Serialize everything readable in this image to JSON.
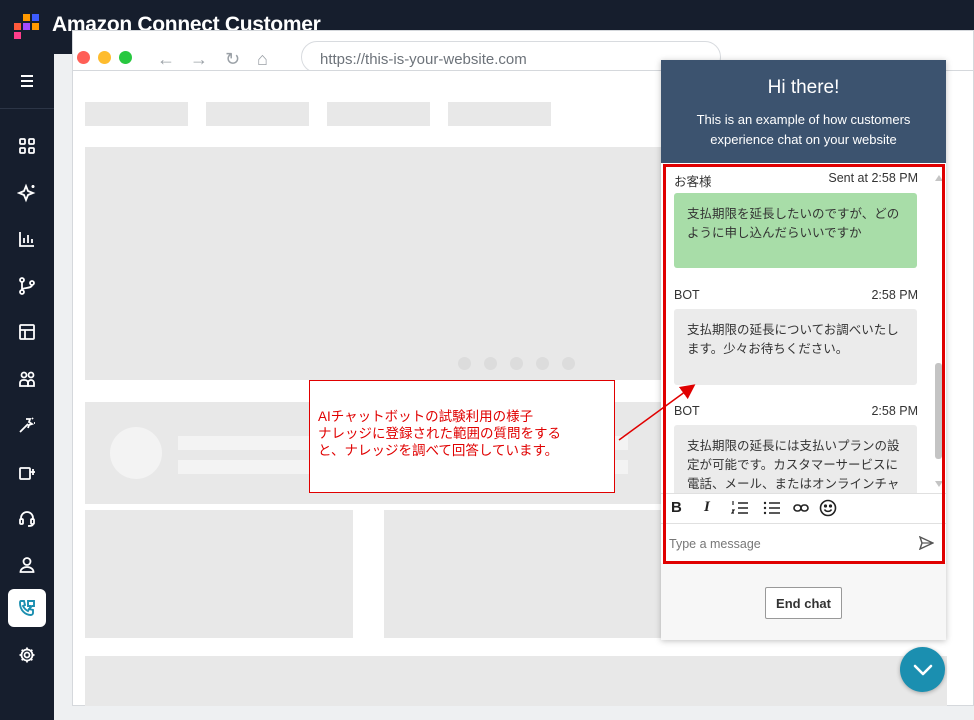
{
  "app": {
    "title": "Amazon Connect Customer",
    "logo_colors": [
      "#ff5a3c",
      "#ff9900",
      "#a44bff",
      "#3d5cff",
      "#ff3d8b"
    ]
  },
  "sidebar": {
    "items": [
      {
        "name": "menu-icon"
      },
      {
        "name": "dashboard-grid-icon"
      },
      {
        "name": "sparkle-ai-icon"
      },
      {
        "name": "analytics-chart-icon"
      },
      {
        "name": "flow-routing-icon"
      },
      {
        "name": "layout-panel-icon"
      },
      {
        "name": "users-group-icon"
      },
      {
        "name": "magic-wand-icon"
      },
      {
        "name": "queue-transfer-icon"
      },
      {
        "name": "headset-icon"
      },
      {
        "name": "user-profile-icon"
      },
      {
        "name": "phone-chat-icon",
        "active": true
      },
      {
        "name": "settings-gear-icon"
      }
    ]
  },
  "browser": {
    "url": "https://this-is-your-website.com"
  },
  "chat": {
    "greeting": "Hi there!",
    "subtitle": "This is an example of how customers experience chat on your website",
    "messages": [
      {
        "sender": "お客様",
        "time": "Sent at  2:58 PM",
        "text": "支払期限を延長したいのですが、どのように申し込んだらいいですか",
        "type": "customer"
      },
      {
        "sender": "BOT",
        "time": "2:58 PM",
        "text": "支払期限の延長についてお調べいたします。少々お待ちください。",
        "type": "bot"
      },
      {
        "sender": "BOT",
        "time": "2:58 PM",
        "text": "支払期限の延長には支払いプランの設定が可能です。カスタマーサービスに電話、メール、またはオンラインチャ",
        "type": "bot"
      }
    ],
    "toolbar": {
      "bold": "B",
      "italic": "I"
    },
    "input_placeholder": "Type a message",
    "end_chat_label": "End chat"
  },
  "callout": {
    "line1": "AIチャットボットの試験利用の様子",
    "line2": "ナレッジに登録された範囲の質問をする",
    "line3": "と、ナレッジを調べて回答しています。"
  },
  "colors": {
    "accent": "#1b8fb0",
    "header": "#3c536f",
    "annotation": "#e00000"
  }
}
